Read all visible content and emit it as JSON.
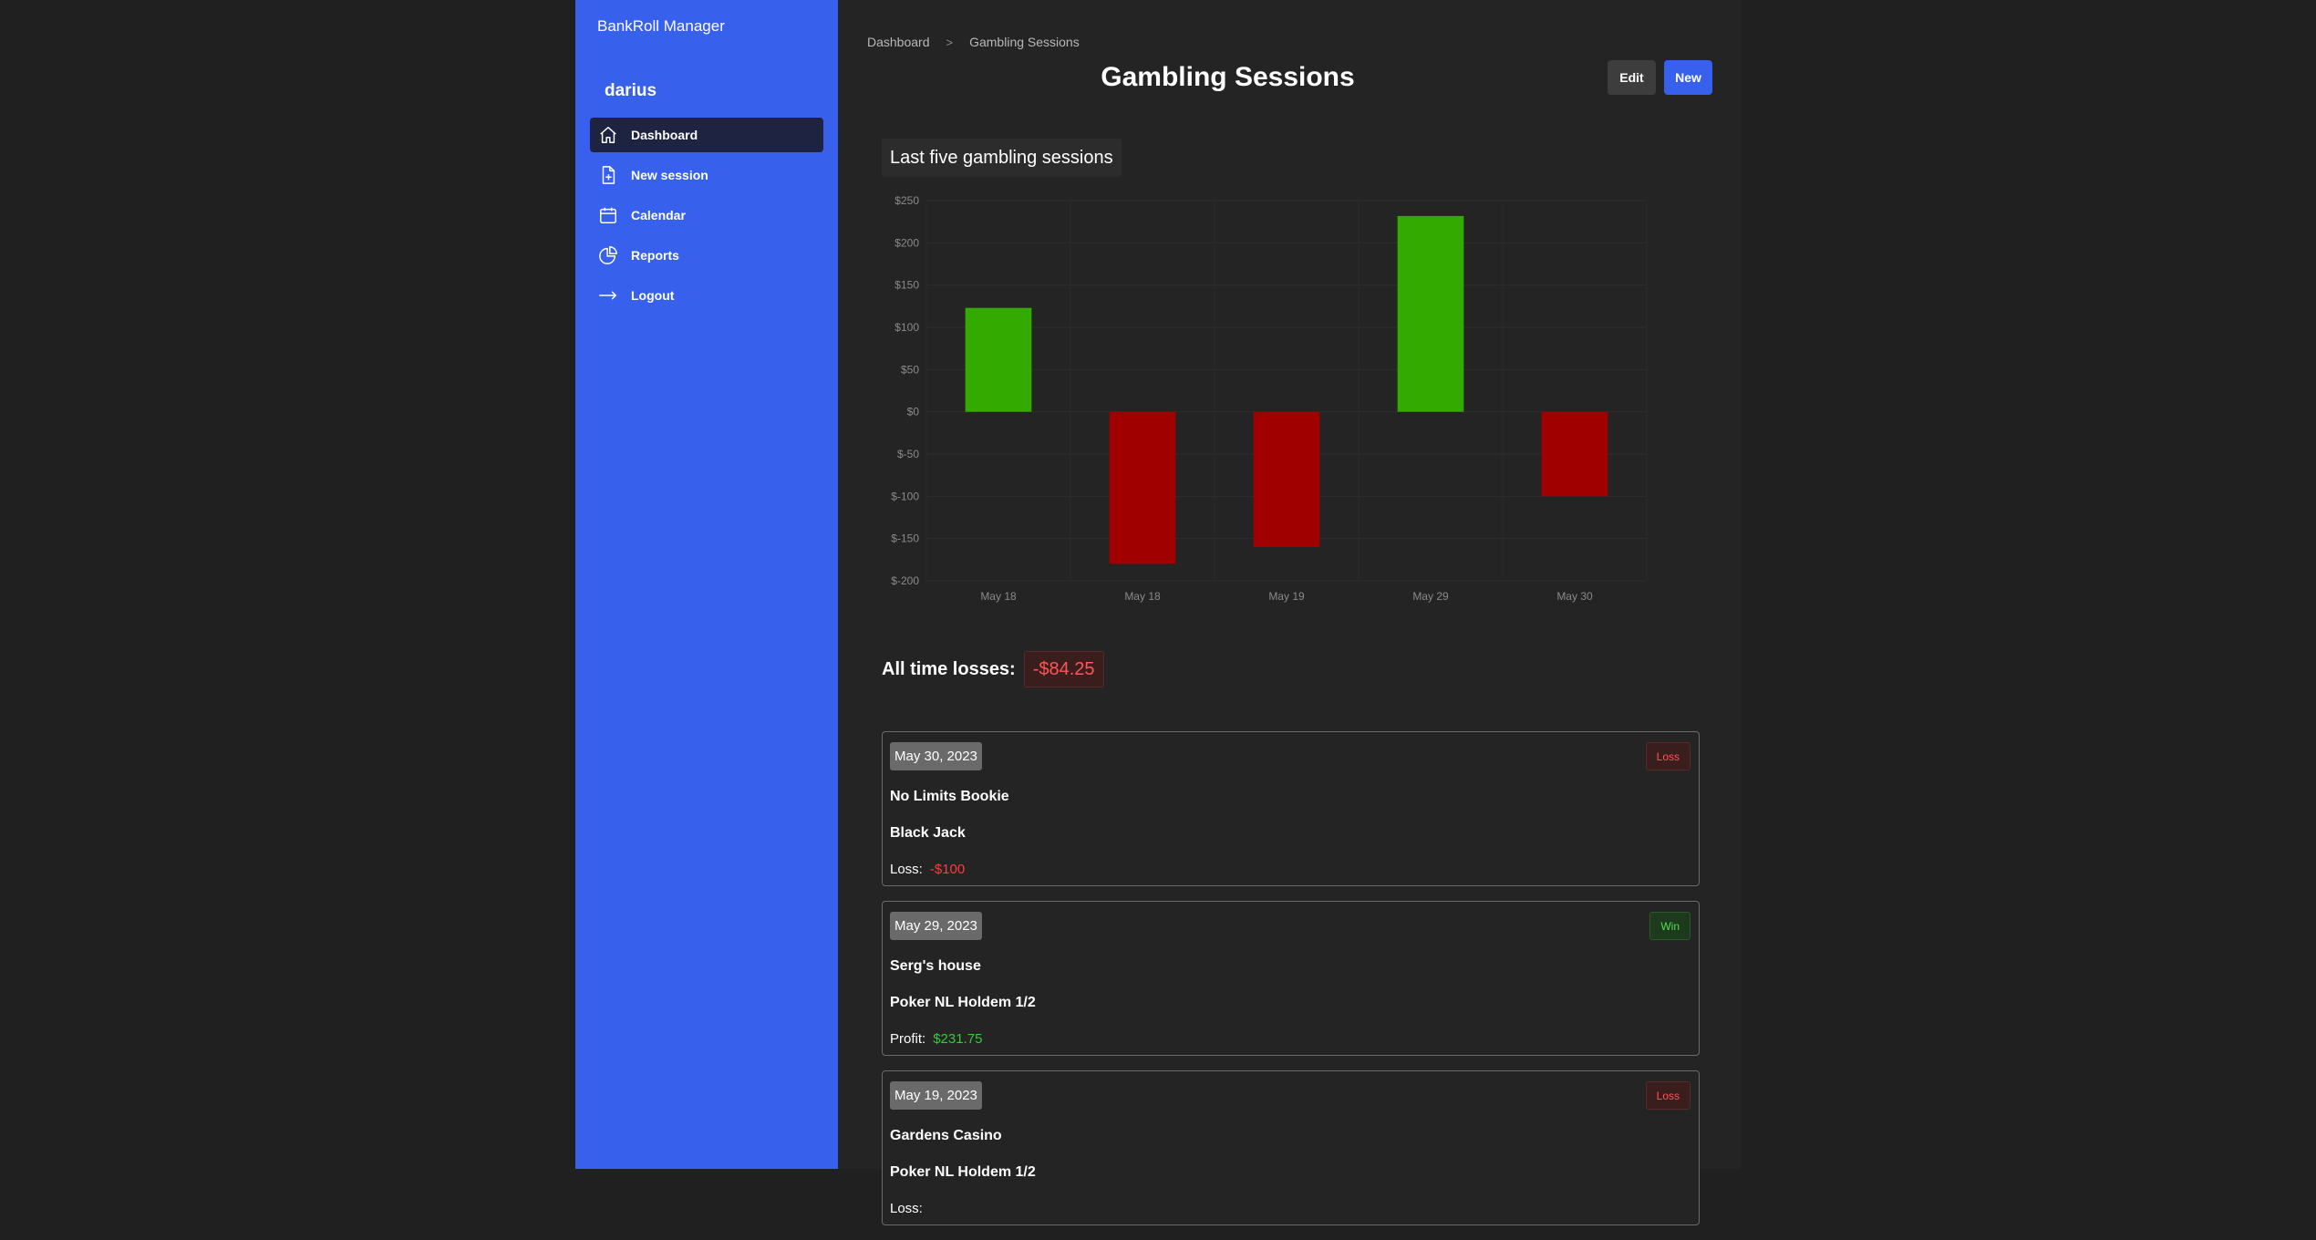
{
  "app": {
    "brand": "BankRoll Manager",
    "user": "darius"
  },
  "sidebar": {
    "items": [
      {
        "label": "Dashboard",
        "icon": "home-icon",
        "active": true
      },
      {
        "label": "New session",
        "icon": "document-plus-icon"
      },
      {
        "label": "Calendar",
        "icon": "calendar-icon"
      },
      {
        "label": "Reports",
        "icon": "chart-pie-icon"
      },
      {
        "label": "Logout",
        "icon": "arrow-right-icon"
      }
    ]
  },
  "breadcrumb": {
    "items": [
      "Dashboard",
      "Gambling Sessions"
    ],
    "separator": ">"
  },
  "page": {
    "title": "Gambling Sessions",
    "edit_label": "Edit",
    "new_label": "New"
  },
  "chart_section": {
    "title": "Last five gambling sessions"
  },
  "chart_data": {
    "type": "bar",
    "categories": [
      "May 18",
      "May 18",
      "May 19",
      "May 29",
      "May 30"
    ],
    "values": [
      123,
      -180,
      -160,
      231.75,
      -100
    ],
    "ylim": [
      -200,
      250
    ],
    "yticks": [
      250,
      200,
      150,
      100,
      50,
      0,
      -50,
      -100,
      -150,
      -200
    ],
    "ytick_labels": [
      "$250",
      "$200",
      "$150",
      "$100",
      "$50",
      "$0",
      "$-50",
      "$-100",
      "$-150",
      "$-200"
    ],
    "grid": true,
    "colors": {
      "positive": "#33aa00",
      "negative": "#a00000"
    },
    "xlabel": "",
    "ylabel": ""
  },
  "totals": {
    "label": "All time losses:",
    "value": "-$84.25"
  },
  "sessions": [
    {
      "date": "May 30, 2023",
      "badge": "Loss",
      "place": "No Limits Bookie",
      "game": "Black Jack",
      "result_label": "Loss:",
      "amount": "-$100",
      "kind": "loss"
    },
    {
      "date": "May 29, 2023",
      "badge": "Win",
      "place": "Serg's house",
      "game": "Poker NL Holdem 1/2",
      "result_label": "Profit:",
      "amount": "$231.75",
      "kind": "win"
    },
    {
      "date": "May 19, 2023",
      "badge": "Loss",
      "place": "Gardens Casino",
      "game": "Poker NL Holdem 1/2",
      "result_label": "Loss:",
      "amount": "",
      "kind": "loss"
    }
  ],
  "colors": {
    "sidebar": "#3761ec",
    "background": "#242424",
    "loss": "#ff3b3b",
    "win": "#33cc33"
  }
}
